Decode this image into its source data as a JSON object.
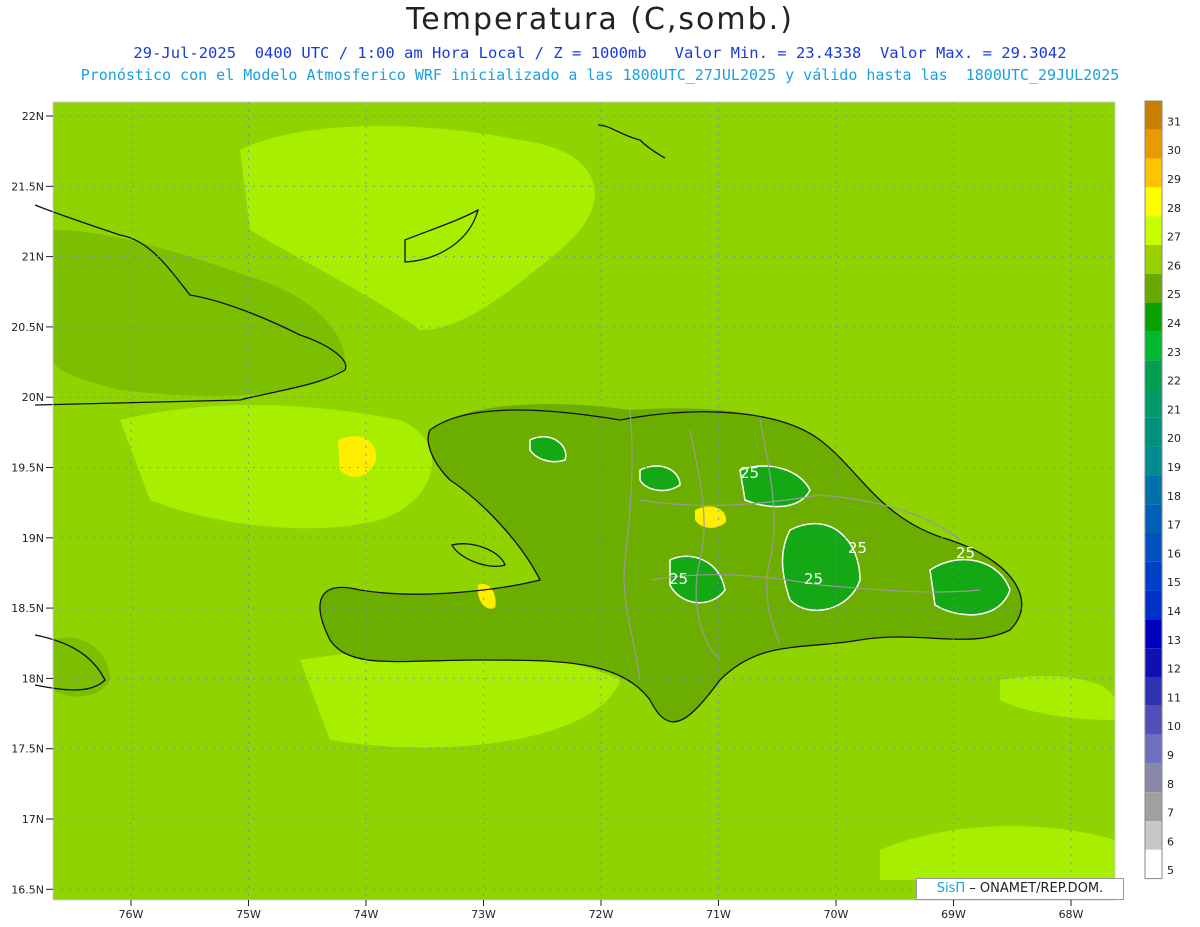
{
  "header": {
    "title": "Temperatura (C,somb.)",
    "line1": "29-Jul-2025  0400 UTC / 1:00 am Hora Local / Z = 1000mb   Valor Min. = 23.4338  Valor Max. = 29.3042",
    "line2": "Pronóstico con el Modelo Atmosferico WRF inicializado a las 1800UTC_27JUL2025 y válido hasta las  1800UTC_29JUL2025"
  },
  "axes": {
    "lat_labels": [
      "22N",
      "21.5N",
      "21N",
      "20.5N",
      "20N",
      "19.5N",
      "19N",
      "18.5N",
      "18N",
      "17.5N",
      "17N",
      "16.5N"
    ],
    "lon_labels": [
      "76W",
      "75W",
      "74W",
      "73W",
      "72W",
      "71W",
      "70W",
      "69W",
      "68W"
    ]
  },
  "contour_labels": [
    "25",
    "25",
    "25",
    "25",
    "25"
  ],
  "colorbar": {
    "levels": [
      "31",
      "30",
      "29",
      "28",
      "27",
      "26",
      "25",
      "24",
      "23",
      "22",
      "21",
      "20",
      "19",
      "18",
      "17",
      "16",
      "15",
      "14",
      "13",
      "12",
      "11",
      "10",
      "9",
      "8",
      "7",
      "6",
      "5"
    ],
    "colors": [
      "#c88000",
      "#e89a00",
      "#ffc400",
      "#ffff00",
      "#c8ff00",
      "#9ad000",
      "#6aa800",
      "#0aa000",
      "#00b830",
      "#00a050",
      "#009a6a",
      "#00907e",
      "#008a92",
      "#0070a8",
      "#0060b8",
      "#0050c0",
      "#0040c8",
      "#0030c8",
      "#0000c0",
      "#1010b0",
      "#3030b0",
      "#5050b8",
      "#7070c0",
      "#8888a8",
      "#a0a0a0",
      "#c8c8c8",
      "#ffffff"
    ]
  },
  "credit": {
    "brand": "SisΠ",
    "text": " – ONAMET/REP.DOM."
  }
}
